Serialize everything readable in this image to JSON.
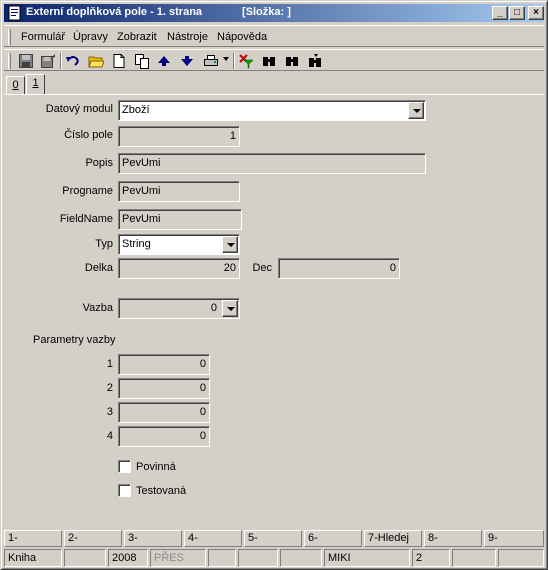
{
  "window": {
    "title": "Externí doplňková pole - 1. strana",
    "folder": "[Složka: ]",
    "buttons": {
      "minimize": "_",
      "maximize": "□",
      "close": "×"
    }
  },
  "menu": [
    "Formulář",
    "Úpravy",
    "Zobrazit",
    "Nástroje",
    "Nápověda"
  ],
  "toolbar": [
    "save-icon",
    "save-as-icon",
    "undo-icon",
    "open-folder-icon",
    "new-document-icon",
    "copy-icon",
    "arrow-up-icon",
    "arrow-down-icon",
    "print-icon",
    "filter-icon",
    "binoculars-icon",
    "binoculars-next-icon",
    "binoculars-prev-icon"
  ],
  "tabs": [
    "0",
    "1"
  ],
  "form": {
    "datovy_modul": {
      "label": "Datový modul",
      "value": "Zboží"
    },
    "cislo_pole": {
      "label": "Číslo pole",
      "value": "1"
    },
    "popis": {
      "label": "Popis",
      "value": "PevUmi"
    },
    "progname": {
      "label": "Progname",
      "value": "PevUmi"
    },
    "fieldname": {
      "label": "FieldName",
      "value": "PevUmi"
    },
    "typ": {
      "label": "Typ",
      "value": "String"
    },
    "delka": {
      "label": "Delka",
      "value": "20"
    },
    "dec": {
      "label": "Dec",
      "value": "0"
    },
    "vazba": {
      "label": "Vazba",
      "value": "0"
    },
    "parametry": {
      "label": "Parametry vazby",
      "rows": [
        {
          "label": "1",
          "value": "0"
        },
        {
          "label": "2",
          "value": "0"
        },
        {
          "label": "3",
          "value": "0"
        },
        {
          "label": "4",
          "value": "0"
        }
      ]
    },
    "povinna": {
      "label": "Povinná",
      "checked": false
    },
    "testovana": {
      "label": "Testovaná",
      "checked": false
    }
  },
  "fkeys": [
    "1-",
    "2-",
    "3-",
    "4-",
    "5-",
    "6-",
    "7-Hledej",
    "8-",
    "9-"
  ],
  "status": [
    "Kniha",
    "",
    "2008",
    "PŘES",
    "",
    "",
    "",
    "MIKI",
    "2",
    "",
    ""
  ],
  "colors": {
    "titlebar_start": "#0a246a",
    "titlebar_end": "#a6caf0",
    "face": "#d4d0c8"
  }
}
